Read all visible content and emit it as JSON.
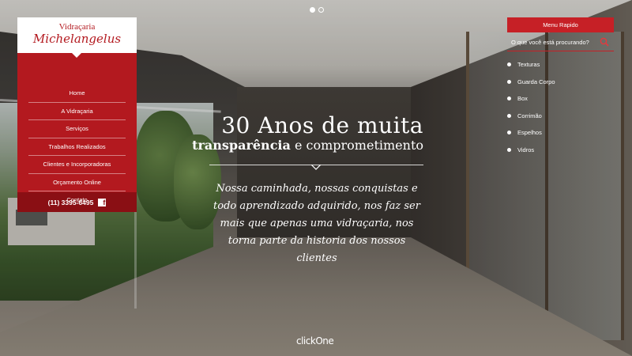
{
  "slider": {
    "slides": 2,
    "active_index": 0
  },
  "logo": {
    "small": "Vidraçaria",
    "big": "Michelangelus"
  },
  "nav": {
    "items": [
      {
        "label": "Home"
      },
      {
        "label": "A Vidraçaria"
      },
      {
        "label": "Serviços"
      },
      {
        "label": "Trabalhos Realizados"
      },
      {
        "label": "Clientes e Incorporadoras"
      },
      {
        "label": "Orçamento Online"
      },
      {
        "label": "Contato"
      }
    ],
    "phone": "(11) 3395-6495",
    "facebook_glyph": "f"
  },
  "hero": {
    "headline": "30 Anos de muita",
    "sub_bold": "transparência",
    "sub_rest": " e comprometimento",
    "script": "Nossa caminhada, nossas conquistas e todo aprendizado adquirido, nos faz ser mais que apenas uma vidraçaria, nos torna parte da historia dos nossos clientes"
  },
  "quick_menu": {
    "title": "Menu Rapido",
    "search_placeholder": "O que você está procurando?",
    "items": [
      {
        "label": "Texturas"
      },
      {
        "label": "Guarda Corpo"
      },
      {
        "label": "Box"
      },
      {
        "label": "Corrimão"
      },
      {
        "label": "Espelhos"
      },
      {
        "label": "Vidros"
      }
    ]
  },
  "credit": "clickOne",
  "colors": {
    "brand_red": "#b3191f",
    "dark_red": "#8a0f14",
    "quick_red": "#c62026"
  }
}
